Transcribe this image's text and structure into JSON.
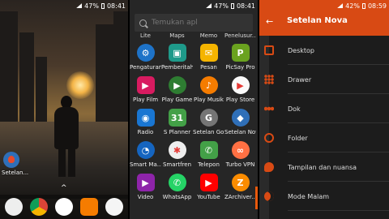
{
  "left": {
    "status": {
      "battery": "47%",
      "time": "08:41"
    },
    "home_app_label": "Setelan...",
    "chevron": "^"
  },
  "drawer": {
    "status": {
      "battery": "47%",
      "time": "08:41"
    },
    "search_placeholder": "Temukan apl",
    "top_labels": [
      "Lite",
      "Maps",
      "Memo",
      "Penelusur..."
    ],
    "apps": [
      {
        "label": "Pengaturan",
        "icon": "gear-icon",
        "color": "#1e73c8",
        "glyph": "⚙",
        "square": false
      },
      {
        "label": "Pemberitah S...",
        "icon": "notification-icon",
        "color": "#1e9a8a",
        "glyph": "▣",
        "square": true
      },
      {
        "label": "Pesan",
        "icon": "mail-icon",
        "color": "#f5b400",
        "glyph": "✉",
        "square": true
      },
      {
        "label": "PicSay Pro",
        "icon": "picsay-icon",
        "color": "#6aa21f",
        "glyph": "P",
        "square": true
      },
      {
        "label": "Play Film",
        "icon": "play-film-icon",
        "color": "#d81b60",
        "glyph": "▶",
        "square": true
      },
      {
        "label": "Play Game",
        "icon": "play-game-icon",
        "color": "#2e7d32",
        "glyph": "▶",
        "square": false
      },
      {
        "label": "Play Musik",
        "icon": "play-music-icon",
        "color": "#f57c00",
        "glyph": "♪",
        "square": false
      },
      {
        "label": "Play Store",
        "icon": "play-store-icon",
        "color": "#fafafa",
        "glyph": "▶",
        "square": false
      },
      {
        "label": "Radio",
        "icon": "radio-icon",
        "color": "#1976d2",
        "glyph": "◉",
        "square": true
      },
      {
        "label": "S Planner",
        "icon": "calendar-icon",
        "color": "#43a047",
        "glyph": "31",
        "square": true
      },
      {
        "label": "Setelan Go...",
        "icon": "google-settings-icon",
        "color": "#757575",
        "glyph": "G",
        "square": false
      },
      {
        "label": "Setelan Nov...",
        "icon": "nova-settings-icon",
        "color": "#2f6fb8",
        "glyph": "◆",
        "square": false
      },
      {
        "label": "Smart Ma...",
        "icon": "smart-manager-icon",
        "color": "#1565c0",
        "glyph": "◔",
        "square": false
      },
      {
        "label": "Smartfren",
        "icon": "smartfren-icon",
        "color": "#eeeeee",
        "glyph": "✱",
        "square": false
      },
      {
        "label": "Telepon",
        "icon": "phone-icon",
        "color": "#43a047",
        "glyph": "✆",
        "square": true
      },
      {
        "label": "Turbo VPN",
        "icon": "vpn-icon",
        "color": "#ff7043",
        "glyph": "∞",
        "square": false
      },
      {
        "label": "Video",
        "icon": "video-icon",
        "color": "#8e24aa",
        "glyph": "▶",
        "square": true
      },
      {
        "label": "WhatsApp",
        "icon": "whatsapp-icon",
        "color": "#25d366",
        "glyph": "✆",
        "square": false
      },
      {
        "label": "YouTube",
        "icon": "youtube-icon",
        "color": "#ff0000",
        "glyph": "▶",
        "square": true
      },
      {
        "label": "ZArchiver...",
        "icon": "zarchiver-icon",
        "color": "#fb8c00",
        "glyph": "Z",
        "square": false
      }
    ]
  },
  "settings": {
    "status": {
      "battery": "42%",
      "time": "08:59"
    },
    "title": "Setelan Nova",
    "back_glyph": "←",
    "accent": "#d84a14",
    "items": [
      {
        "label": "Desktop",
        "icon": "desktop-icon"
      },
      {
        "label": "Drawer",
        "icon": "drawer-icon"
      },
      {
        "label": "Dok",
        "icon": "dock-icon"
      },
      {
        "label": "Folder",
        "icon": "folder-icon"
      },
      {
        "label": "Tampilan dan nuansa",
        "icon": "palette-icon"
      },
      {
        "label": "Mode Malam",
        "icon": "night-mode-icon"
      }
    ]
  }
}
